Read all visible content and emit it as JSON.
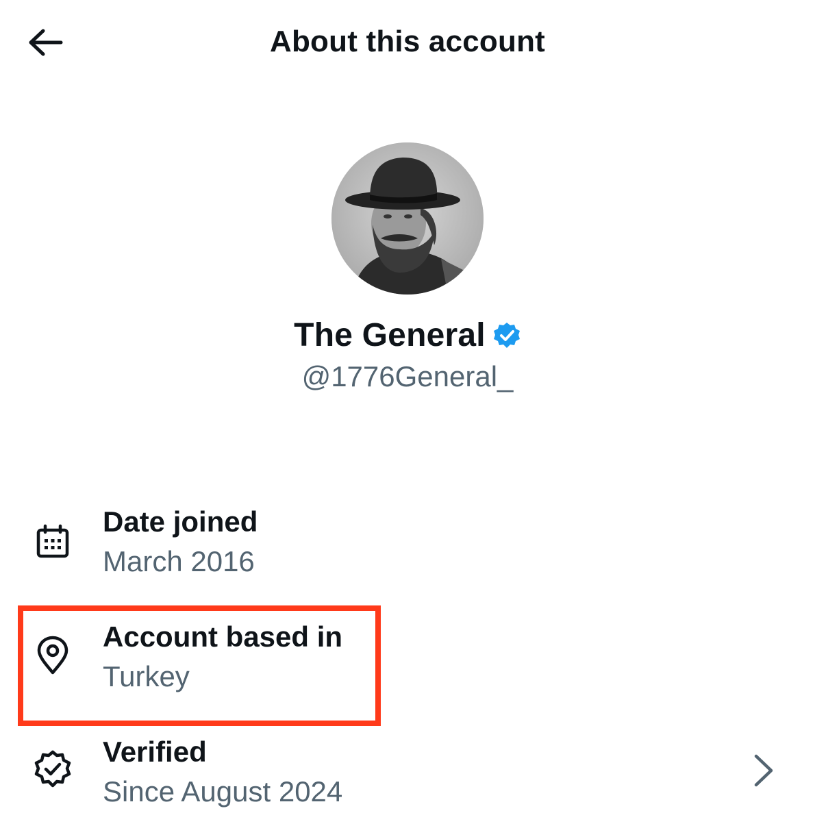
{
  "header": {
    "title": "About this account"
  },
  "profile": {
    "name": "The General",
    "handle": "@1776General_",
    "verified": true
  },
  "info": {
    "date_joined": {
      "label": "Date joined",
      "value": "March 2016",
      "icon": "calendar-icon"
    },
    "based_in": {
      "label": "Account based in",
      "value": "Turkey",
      "icon": "location-pin-icon",
      "highlighted": true
    },
    "verified": {
      "label": "Verified",
      "value": "Since August 2024",
      "icon": "verified-seal-icon"
    }
  },
  "colors": {
    "text_primary": "#0f1419",
    "text_secondary": "#536471",
    "verified_blue": "#1d9bf0",
    "highlight_red": "#ff3a1a"
  }
}
